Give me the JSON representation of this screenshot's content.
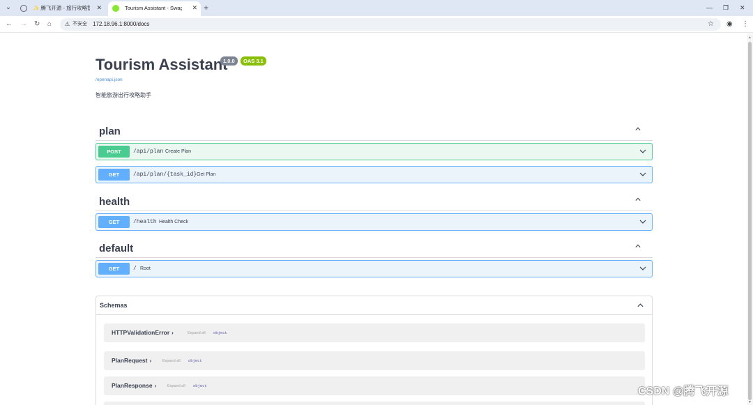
{
  "browser": {
    "tabs": [
      {
        "title": "✨ 腾飞开源 - 旅行攻略智能助"
      },
      {
        "title": "Tourism Assistant - Swagger"
      }
    ],
    "address": {
      "security_label": "不安全",
      "url": "172.18.96.1:8000/docs"
    }
  },
  "api": {
    "title": "Tourism Assistant",
    "version": "1.0.0",
    "oas": "OAS 3.1",
    "spec_link": "/openapi.json",
    "description": "智能旅游出行攻略助手"
  },
  "tags": [
    {
      "name": "plan",
      "operations": [
        {
          "method": "POST",
          "path": "/api/plan",
          "summary": "Create Plan"
        },
        {
          "method": "GET",
          "path": "/api/plan/{task_id}",
          "summary": "Get Plan"
        }
      ]
    },
    {
      "name": "health",
      "operations": [
        {
          "method": "GET",
          "path": "/health",
          "summary": "Health Check"
        }
      ]
    },
    {
      "name": "default",
      "operations": [
        {
          "method": "GET",
          "path": "/",
          "summary": "Root"
        }
      ]
    }
  ],
  "schemas": {
    "title": "Schemas",
    "models": [
      {
        "name": "HTTPValidationError",
        "expand": "Expand all",
        "type": "object"
      },
      {
        "name": "PlanRequest",
        "expand": "Expand all",
        "type": "object"
      },
      {
        "name": "PlanResponse",
        "expand": "Expand all",
        "type": "object"
      }
    ]
  },
  "watermark": "CSDN @腾飞开源",
  "colors": {
    "post": "#49cc90",
    "get": "#61affe",
    "oas_badge": "#89bf04",
    "version_badge": "#7d8492"
  },
  "icons": [
    "chrome-menu-icon",
    "globe-icon",
    "swagger-icon",
    "back-icon",
    "forward-icon",
    "reload-icon",
    "home-icon",
    "warning-icon",
    "star-icon",
    "profile-icon",
    "kebab-menu-icon",
    "chevron-up-icon",
    "chevron-down-icon"
  ]
}
